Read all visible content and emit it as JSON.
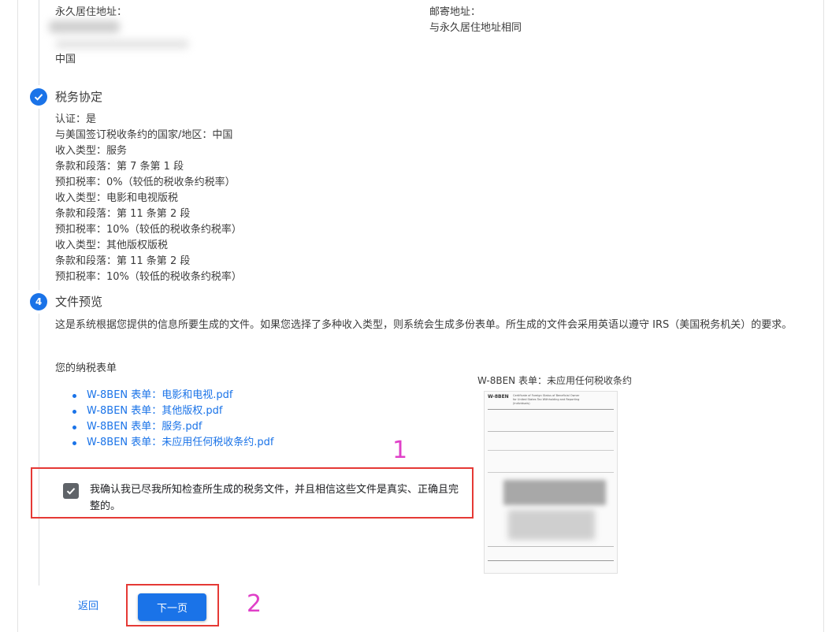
{
  "address": {
    "permanent_label": "永久居住地址：",
    "permanent_country": "中国",
    "mailing_label": "邮寄地址：",
    "mailing_value": "与永久居住地址相同"
  },
  "tax_treaty": {
    "step_title": "税务协定",
    "details": [
      "认证：是",
      "与美国签订税收条约的国家/地区：中国",
      "收入类型：服务",
      "条款和段落：第 7 条第 1 段",
      "预扣税率：0%（较低的税收条约税率）",
      "收入类型：电影和电视版税",
      "条款和段落：第 11 条第 2 段",
      "预扣税率：10%（较低的税收条约税率）",
      "收入类型：其他版权版税",
      "条款和段落：第 11 条第 2 段",
      "预扣税率：10%（较低的税收条约税率）"
    ]
  },
  "file_preview": {
    "step_number": "4",
    "step_title": "文件预览",
    "description": "这是系统根据您提供的信息所要生成的文件。如果您选择了多种收入类型，则系统会生成多份表单。所生成的文件会采用英语以遵守 IRS（美国税务机关）的要求。",
    "forms_heading": "您的纳税表单",
    "pdf_links": [
      "W-8BEN 表单：电影和电视.pdf",
      "W-8BEN 表单：其他版权.pdf",
      "W-8BEN 表单：服务.pdf",
      "W-8BEN 表单：未应用任何税收条约.pdf"
    ],
    "preview_title": "W-8BEN 表单：未应用任何税收条约",
    "thumbnail": {
      "form_code": "W-8BEN",
      "heading": "Certificate of Foreign Status of Beneficial Owner for United States Tax Withholding and Reporting (Individuals)"
    },
    "confirm_text": "我确认我已尽我所知检查所生成的税务文件，并且相信这些文件是真实、正确且完整的。",
    "confirm_checked": true
  },
  "navigation": {
    "back_label": "返回",
    "next_label": "下一页"
  },
  "annotations": {
    "marker_1": "1",
    "marker_2": "2",
    "box_color": "#e53935",
    "number_color": "#e040c8"
  },
  "colors": {
    "accent": "#1a73e8",
    "checkbox": "#5f6368"
  }
}
